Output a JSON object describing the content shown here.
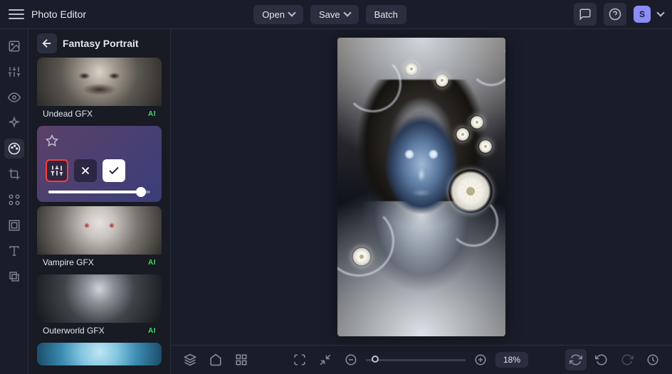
{
  "app": {
    "title": "Photo Editor",
    "avatarLetter": "S"
  },
  "topbar": {
    "open": "Open",
    "save": "Save",
    "batch": "Batch"
  },
  "sidebar": {
    "title": "Fantasy Portrait",
    "aiTag": "AI",
    "effects": [
      {
        "label": "Undead GFX"
      },
      {
        "label": "Vampire GFX"
      },
      {
        "label": "Outerworld GFX"
      }
    ]
  },
  "bottombar": {
    "zoomLabel": "18%"
  }
}
